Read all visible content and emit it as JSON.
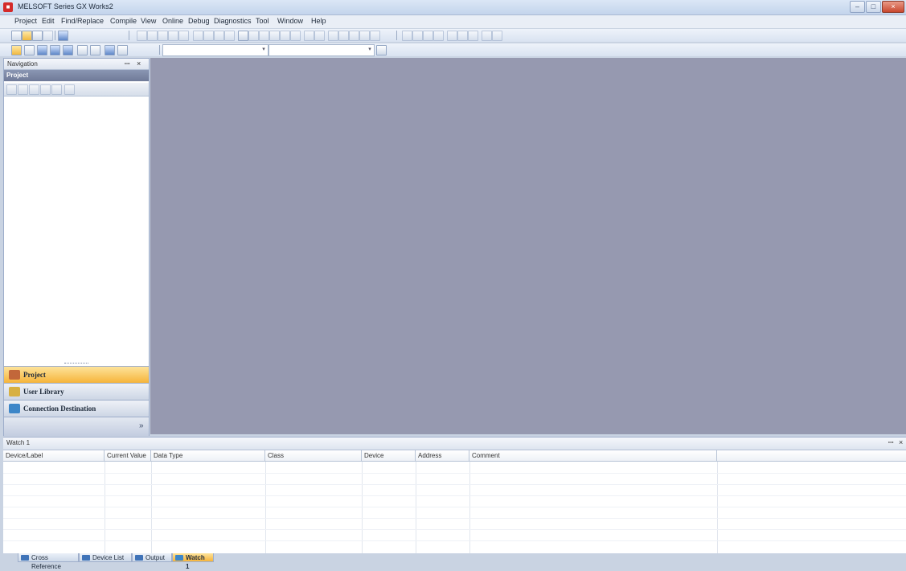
{
  "window": {
    "title": "MELSOFT Series GX Works2",
    "app_icon_glyph": "■",
    "minimize_glyph": "–",
    "maximize_glyph": "□",
    "close_glyph": "×"
  },
  "menu": [
    {
      "label": "Project"
    },
    {
      "label": "Edit"
    },
    {
      "label": "Find/Replace"
    },
    {
      "label": "Compile"
    },
    {
      "label": "View"
    },
    {
      "label": "Online"
    },
    {
      "label": "Debug"
    },
    {
      "label": "Diagnostics"
    },
    {
      "label": "Tool"
    },
    {
      "label": "Window"
    },
    {
      "label": "Help"
    }
  ],
  "navigation": {
    "title": "Navigation",
    "pin_glyph": "ꟷ",
    "close_glyph": "×",
    "section_header": "Project",
    "buttons": [
      {
        "label": "Project",
        "icon": "project-icon",
        "color": "#c2673a",
        "active": true
      },
      {
        "label": "User Library",
        "icon": "user-library-icon",
        "color": "#d7b042",
        "active": false
      },
      {
        "label": "Connection Destination",
        "icon": "connection-destination-icon",
        "color": "#3d86c8",
        "active": false
      }
    ],
    "expand_glyph": "»"
  },
  "watch": {
    "title": "Watch 1",
    "pin_glyph": "ꟷ",
    "close_glyph": "×",
    "columns": [
      "Device/Label",
      "Current Value",
      "Data Type",
      "Class",
      "Device",
      "Address",
      "Comment",
      ""
    ]
  },
  "bottom_tabs": [
    {
      "label": "Cross Reference",
      "icon": "cross-reference-icon",
      "active": false
    },
    {
      "label": "Device List",
      "icon": "device-list-icon",
      "active": false
    },
    {
      "label": "Output",
      "icon": "output-icon",
      "active": false
    },
    {
      "label": "Watch 1",
      "icon": "watch-icon",
      "active": true
    }
  ],
  "colors": {
    "workspace": "#9699b0",
    "active_nav": "#f6b43a",
    "project_header": "#7b86a5"
  }
}
